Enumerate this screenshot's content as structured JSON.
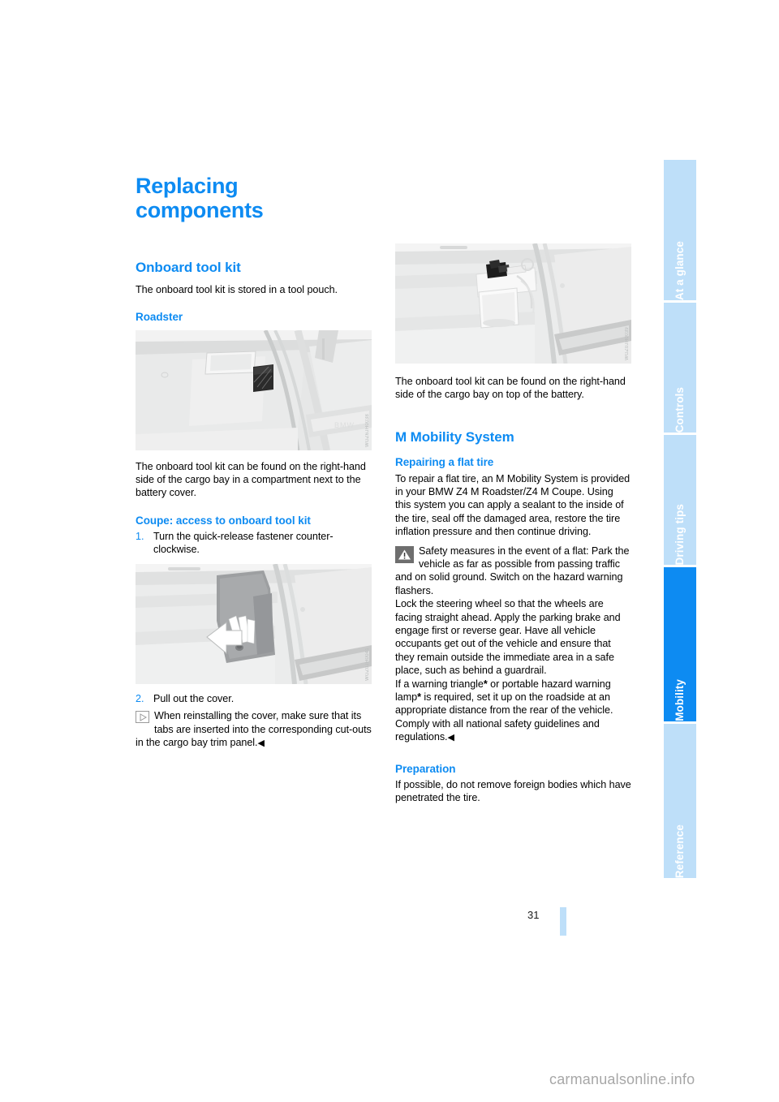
{
  "page": {
    "number": "31",
    "watermark": "carmanualsonline.info"
  },
  "sidebar": {
    "tabs": [
      {
        "label": "At a glance",
        "active": false
      },
      {
        "label": "Controls",
        "active": false
      },
      {
        "label": "Driving tips",
        "active": false
      },
      {
        "label": "Mobility",
        "active": true
      },
      {
        "label": "Reference",
        "active": false
      }
    ],
    "colors": {
      "inactive": "#bedff9",
      "active": "#0d8bf2",
      "label": "#ffffff"
    }
  },
  "colors": {
    "heading_blue": "#0d8bf2",
    "body_black": "#000000",
    "figure_bg": "#e9eaea"
  },
  "left_column": {
    "title": "Replacing components",
    "section_heading": "Onboard tool kit",
    "intro": "The onboard tool kit is stored in a tool pouch.",
    "sub_roadster": "Roadster",
    "figure_roadster": {
      "name": "roadster-cargo-bay-photo",
      "code": "WGZ6JH0038"
    },
    "roadster_text": "The onboard tool kit can be found on the right-hand side of the cargo bay in a compartment next to the battery cover.",
    "sub_coupe": "Coupe: access to onboard tool kit",
    "steps": [
      {
        "number": "1.",
        "text": "Turn the quick-release fastener counter-clockwise."
      },
      {
        "number": "2.",
        "text": "Pull out the cover."
      }
    ],
    "figure_coupe": {
      "name": "coupe-cover-arrow-photo",
      "code": "WGZ0JH0041"
    },
    "note": {
      "icon": "note-triangle-icon",
      "text": "When reinstalling the cover, make sure that its tabs are inserted into the corresponding cut-outs in the cargo bay trim panel.",
      "end_mark": "◀"
    }
  },
  "right_column": {
    "figure_battery": {
      "name": "battery-cargo-bay-photo",
      "code": "WGZ0JH0039"
    },
    "battery_text": "The onboard tool kit can be found on the right-hand side of the cargo bay on top of the battery.",
    "section_heading": "M Mobility System",
    "sub_repair": "Repairing a flat tire",
    "repair_text": "To repair a flat tire, an M Mobility System is provided in your BMW Z4 M Roadster/Z4 M Coupe. Using this system you can apply a sealant to the inside of the tire, seal off the damaged area, restore the tire inflation pressure and then continue driving.",
    "warning": {
      "icon": "warning-triangle-icon",
      "paragraph_1": "Safety measures in the event of a flat: Park the vehicle as far as possible from passing traffic and on solid ground. Switch on the hazard warning flashers.",
      "paragraph_2": "Lock the steering wheel so that the wheels are facing straight ahead. Apply the parking brake and engage first or reverse gear. Have all vehicle occupants get out of the vehicle and ensure that they remain outside the immediate area in a safe place, such as behind a guardrail.",
      "paragraph_3_a": "If a warning triangle",
      "asterisk": "*",
      "paragraph_3_b": " or portable hazard warning lamp",
      "paragraph_3_c": " is required, set it up on the roadside at an appropriate distance from the rear of the vehicle. Comply with all national safety guidelines and regulations.",
      "end_mark": "◀"
    },
    "sub_preparation": "Preparation",
    "preparation_text": "If possible, do not remove foreign bodies which have penetrated the tire."
  }
}
